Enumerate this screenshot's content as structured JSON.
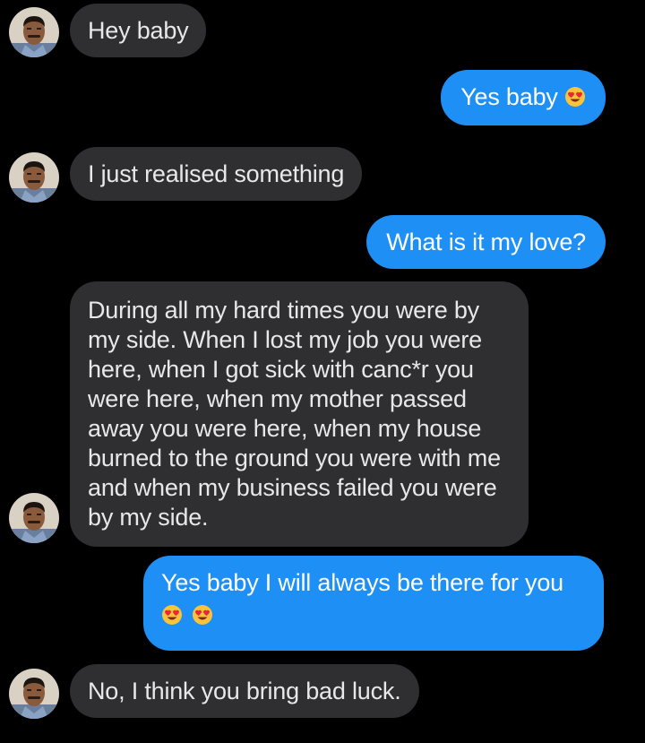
{
  "conversation": {
    "messages": [
      {
        "sender": "contact",
        "text": "Hey baby"
      },
      {
        "sender": "me",
        "text": "Yes baby",
        "emoji": "heart-eyes-emoji"
      },
      {
        "sender": "contact",
        "text": "I just realised something"
      },
      {
        "sender": "me",
        "text": "What is it my love?"
      },
      {
        "sender": "contact",
        "text": "During all my hard times you were by my side. When I lost my job you were here, when I got sick with canc*r you were here, when my mother passed away you were here, when my house burned to the ground you were with me and when my business failed you were by my side."
      },
      {
        "sender": "me",
        "text": "Yes baby I will always be there for you",
        "emoji": "heart-eyes-emoji x2"
      },
      {
        "sender": "contact",
        "text": "No, I think you bring bad luck."
      }
    ]
  },
  "colors": {
    "background": "#000000",
    "incoming_bubble": "#2f2f31",
    "outgoing_bubble": "#1d8ff5",
    "incoming_text": "#e8e8e8",
    "outgoing_text": "#ffffff"
  },
  "icons": {
    "avatar": "contact-avatar",
    "emoji": "heart-eyes-emoji"
  }
}
